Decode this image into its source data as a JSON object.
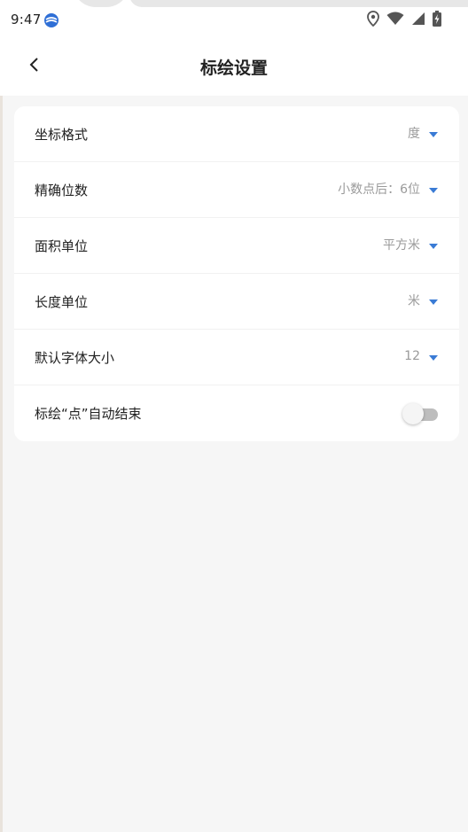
{
  "status_bar": {
    "time": "9:47",
    "icons": [
      "location-icon",
      "wifi-icon",
      "signal-icon",
      "battery-charging-icon"
    ]
  },
  "header": {
    "title": "标绘设置",
    "back_icon": "chevron-left-icon"
  },
  "settings": {
    "rows": [
      {
        "label": "坐标格式",
        "value": "度"
      },
      {
        "label": "精确位数",
        "value": "小数点后：6位"
      },
      {
        "label": "面积单位",
        "value": "平方米"
      },
      {
        "label": "长度单位",
        "value": "米"
      },
      {
        "label": "默认字体大小",
        "value": "12"
      }
    ],
    "toggle_row": {
      "label": "标绘“点”自动结束",
      "enabled": false
    }
  },
  "colors": {
    "accent": "#3a7bd5",
    "background": "#f6f6f6",
    "card": "#ffffff",
    "value_text": "#9a9a9a"
  }
}
